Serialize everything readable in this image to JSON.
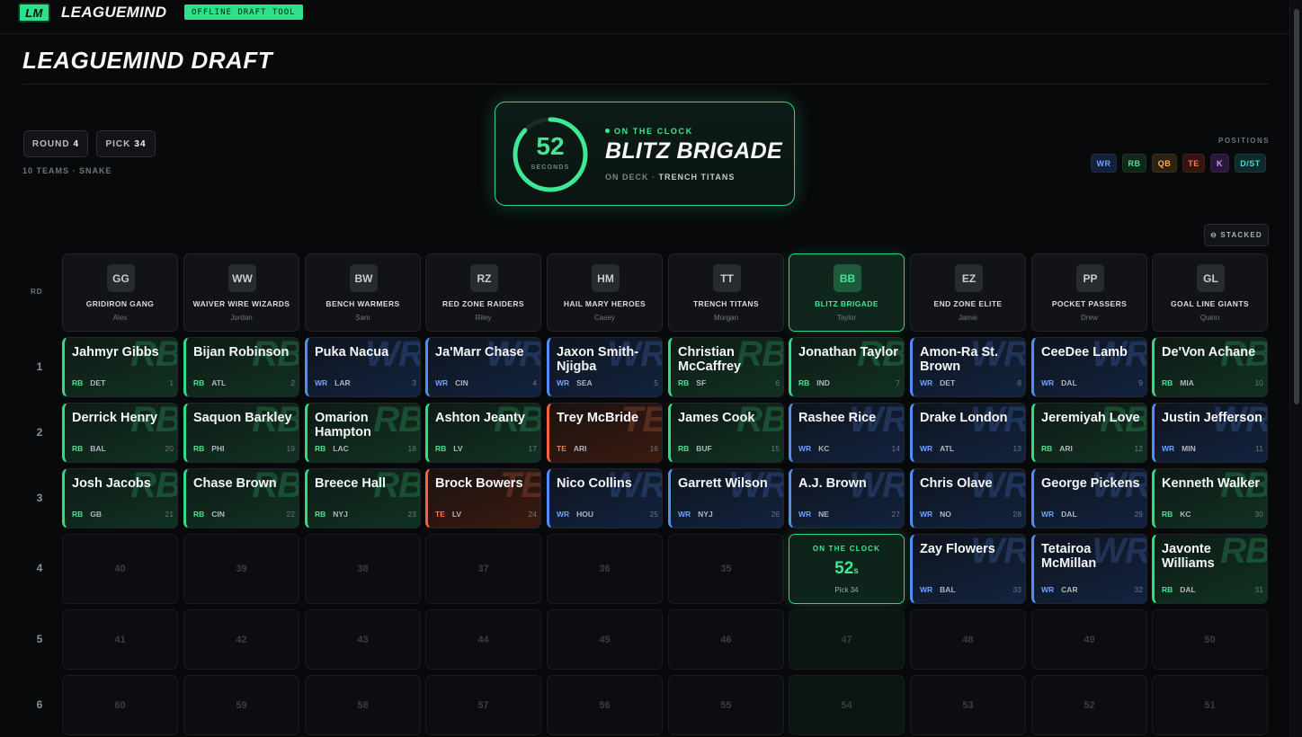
{
  "app": {
    "logo_text": "LM",
    "brand": "LEAGUEMIND",
    "tool_tag": "OFFLINE DRAFT TOOL"
  },
  "page": {
    "title": "LEAGUEMIND DRAFT"
  },
  "status": {
    "round_label": "ROUND",
    "round_value": "4",
    "pick_label": "PICK",
    "pick_value": "34",
    "league_meta": "10 TEAMS · SNAKE"
  },
  "on_the_clock": {
    "seconds": "52",
    "seconds_label": "SECONDS",
    "timer_fraction": 0.87,
    "label": "ON THE CLOCK",
    "team": "BLITZ BRIGADE",
    "on_deck_label": "ON DECK ·",
    "on_deck_team": "TRENCH TITANS"
  },
  "positions": {
    "label": "POSITIONS",
    "chips": [
      "WR",
      "RB",
      "QB",
      "TE",
      "K",
      "D/ST"
    ]
  },
  "view_toggle": {
    "label": "⊖ STACKED"
  },
  "board": {
    "rd_label": "RD",
    "rounds": [
      "1",
      "2",
      "3",
      "4",
      "5",
      "6"
    ],
    "active_team_index": 6,
    "teams": [
      {
        "abbr": "GG",
        "name": "GRIDIRON GANG",
        "owner": "Alex"
      },
      {
        "abbr": "WW",
        "name": "WAIVER WIRE WIZARDS",
        "owner": "Jordan"
      },
      {
        "abbr": "BW",
        "name": "BENCH WARMERS",
        "owner": "Sam"
      },
      {
        "abbr": "RZ",
        "name": "RED ZONE RAIDERS",
        "owner": "Riley"
      },
      {
        "abbr": "HM",
        "name": "HAIL MARY HEROES",
        "owner": "Casey"
      },
      {
        "abbr": "TT",
        "name": "TRENCH TITANS",
        "owner": "Morgan"
      },
      {
        "abbr": "BB",
        "name": "BLITZ BRIGADE",
        "owner": "Taylor"
      },
      {
        "abbr": "EZ",
        "name": "END ZONE ELITE",
        "owner": "Jamie"
      },
      {
        "abbr": "PP",
        "name": "POCKET PASSERS",
        "owner": "Drew"
      },
      {
        "abbr": "GL",
        "name": "GOAL LINE GIANTS",
        "owner": "Quinn"
      }
    ],
    "rows": [
      [
        {
          "type": "pick",
          "name": "Jahmyr Gibbs",
          "pos": "RB",
          "team": "DET",
          "num": "1"
        },
        {
          "type": "pick",
          "name": "Bijan Robinson",
          "pos": "RB",
          "team": "ATL",
          "num": "2"
        },
        {
          "type": "pick",
          "name": "Puka Nacua",
          "pos": "WR",
          "team": "LAR",
          "num": "3"
        },
        {
          "type": "pick",
          "name": "Ja'Marr Chase",
          "pos": "WR",
          "team": "CIN",
          "num": "4"
        },
        {
          "type": "pick",
          "name": "Jaxon Smith-Njigba",
          "pos": "WR",
          "team": "SEA",
          "num": "5"
        },
        {
          "type": "pick",
          "name": "Christian McCaffrey",
          "pos": "RB",
          "team": "SF",
          "num": "6"
        },
        {
          "type": "pick",
          "name": "Jonathan Taylor",
          "pos": "RB",
          "team": "IND",
          "num": "7"
        },
        {
          "type": "pick",
          "name": "Amon-Ra St. Brown",
          "pos": "WR",
          "team": "DET",
          "num": "8"
        },
        {
          "type": "pick",
          "name": "CeeDee Lamb",
          "pos": "WR",
          "team": "DAL",
          "num": "9"
        },
        {
          "type": "pick",
          "name": "De'Von Achane",
          "pos": "RB",
          "team": "MIA",
          "num": "10"
        }
      ],
      [
        {
          "type": "pick",
          "name": "Derrick Henry",
          "pos": "RB",
          "team": "BAL",
          "num": "20"
        },
        {
          "type": "pick",
          "name": "Saquon Barkley",
          "pos": "RB",
          "team": "PHI",
          "num": "19"
        },
        {
          "type": "pick",
          "name": "Omarion Hampton",
          "pos": "RB",
          "team": "LAC",
          "num": "18"
        },
        {
          "type": "pick",
          "name": "Ashton Jeanty",
          "pos": "RB",
          "team": "LV",
          "num": "17"
        },
        {
          "type": "pick",
          "name": "Trey McBride",
          "pos": "TE",
          "team": "ARI",
          "num": "16"
        },
        {
          "type": "pick",
          "name": "James Cook",
          "pos": "RB",
          "team": "BUF",
          "num": "15"
        },
        {
          "type": "pick",
          "name": "Rashee Rice",
          "pos": "WR",
          "team": "KC",
          "num": "14"
        },
        {
          "type": "pick",
          "name": "Drake London",
          "pos": "WR",
          "team": "ATL",
          "num": "13"
        },
        {
          "type": "pick",
          "name": "Jeremiyah Love",
          "pos": "RB",
          "team": "ARI",
          "num": "12"
        },
        {
          "type": "pick",
          "name": "Justin Jefferson",
          "pos": "WR",
          "team": "MIN",
          "num": "11"
        }
      ],
      [
        {
          "type": "pick",
          "name": "Josh Jacobs",
          "pos": "RB",
          "team": "GB",
          "num": "21"
        },
        {
          "type": "pick",
          "name": "Chase Brown",
          "pos": "RB",
          "team": "CIN",
          "num": "22"
        },
        {
          "type": "pick",
          "name": "Breece Hall",
          "pos": "RB",
          "team": "NYJ",
          "num": "23"
        },
        {
          "type": "pick",
          "name": "Brock Bowers",
          "pos": "TE",
          "team": "LV",
          "num": "24"
        },
        {
          "type": "pick",
          "name": "Nico Collins",
          "pos": "WR",
          "team": "HOU",
          "num": "25"
        },
        {
          "type": "pick",
          "name": "Garrett Wilson",
          "pos": "WR",
          "team": "NYJ",
          "num": "26"
        },
        {
          "type": "pick",
          "name": "A.J. Brown",
          "pos": "WR",
          "team": "NE",
          "num": "27"
        },
        {
          "type": "pick",
          "name": "Chris Olave",
          "pos": "WR",
          "team": "NO",
          "num": "28"
        },
        {
          "type": "pick",
          "name": "George Pickens",
          "pos": "WR",
          "team": "DAL",
          "num": "29"
        },
        {
          "type": "pick",
          "name": "Kenneth Walker",
          "pos": "RB",
          "team": "KC",
          "num": "30"
        }
      ],
      [
        {
          "type": "empty",
          "num": "40"
        },
        {
          "type": "empty",
          "num": "39"
        },
        {
          "type": "empty",
          "num": "38"
        },
        {
          "type": "empty",
          "num": "37"
        },
        {
          "type": "empty",
          "num": "36"
        },
        {
          "type": "empty",
          "num": "35"
        },
        {
          "type": "clock",
          "label": "ON THE CLOCK",
          "seconds": "52",
          "unit": "s",
          "pick": "Pick 34"
        },
        {
          "type": "pick",
          "name": "Zay Flowers",
          "pos": "WR",
          "team": "BAL",
          "num": "33"
        },
        {
          "type": "pick",
          "name": "Tetairoa McMillan",
          "pos": "WR",
          "team": "CAR",
          "num": "32"
        },
        {
          "type": "pick",
          "name": "Javonte Williams",
          "pos": "RB",
          "team": "DAL",
          "num": "31"
        }
      ],
      [
        {
          "type": "empty",
          "num": "41"
        },
        {
          "type": "empty",
          "num": "42"
        },
        {
          "type": "empty",
          "num": "43"
        },
        {
          "type": "empty",
          "num": "44"
        },
        {
          "type": "empty",
          "num": "45"
        },
        {
          "type": "empty",
          "num": "46"
        },
        {
          "type": "empty",
          "num": "47"
        },
        {
          "type": "empty",
          "num": "48"
        },
        {
          "type": "empty",
          "num": "49"
        },
        {
          "type": "empty",
          "num": "50"
        }
      ],
      [
        {
          "type": "empty",
          "num": "60"
        },
        {
          "type": "empty",
          "num": "59"
        },
        {
          "type": "empty",
          "num": "58"
        },
        {
          "type": "empty",
          "num": "57"
        },
        {
          "type": "empty",
          "num": "56"
        },
        {
          "type": "empty",
          "num": "55"
        },
        {
          "type": "empty",
          "num": "54"
        },
        {
          "type": "empty",
          "num": "53"
        },
        {
          "type": "empty",
          "num": "52"
        },
        {
          "type": "empty",
          "num": "51"
        }
      ]
    ]
  }
}
